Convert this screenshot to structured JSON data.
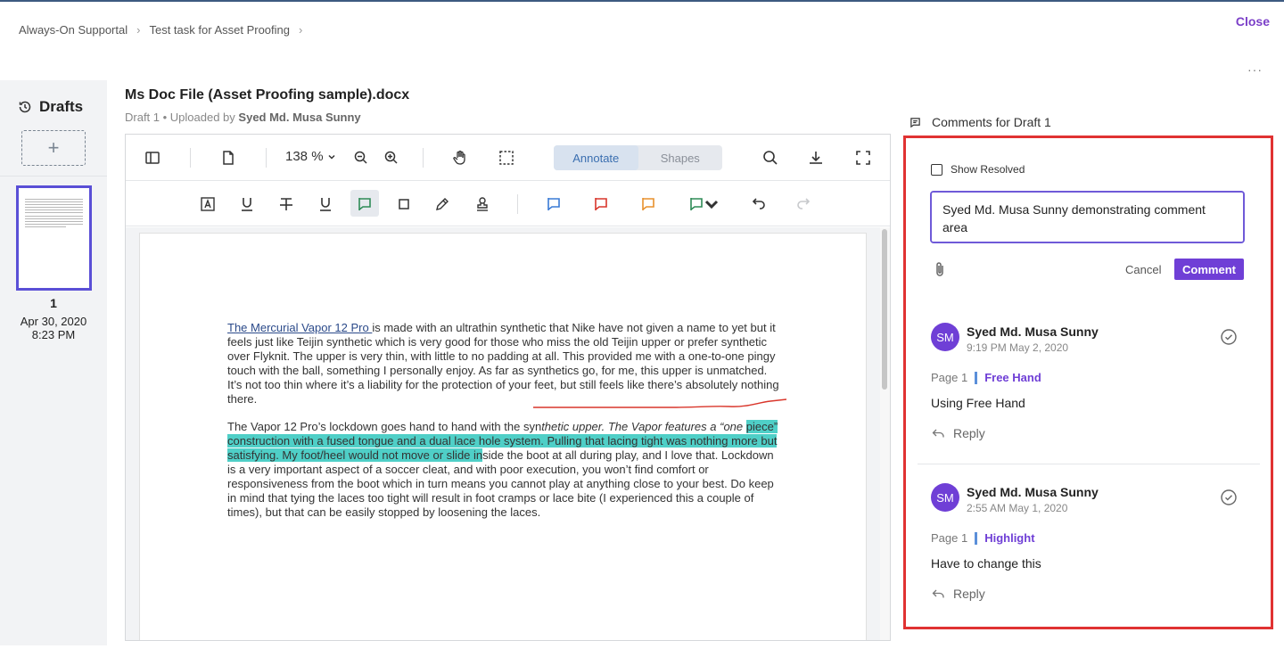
{
  "breadcrumb": {
    "items": [
      "Always-On Supportal",
      "Test task for Asset Proofing"
    ],
    "separator": "›"
  },
  "header": {
    "close_label": "Close",
    "more_label": "···"
  },
  "drafts": {
    "title": "Drafts",
    "add_label": "+",
    "items": [
      {
        "number": "1",
        "date": "Apr 30, 2020",
        "time": "8:23 PM"
      }
    ]
  },
  "document": {
    "title": "Ms Doc File (Asset Proofing sample).docx",
    "draft_label": "Draft 1 • Uploaded by",
    "uploader": "Syed Md. Musa Sunny"
  },
  "toolbar": {
    "zoom": "138 %",
    "modes": [
      "Annotate",
      "Shapes"
    ],
    "active_mode": "Annotate"
  },
  "page_content": {
    "p1_link": "The Mercurial Vapor 12 Pro ",
    "p1_rest": "is made with an ultrathin synthetic that Nike have not given a name to yet but it feels just like Teijin synthetic which is very good for those who miss the old Teijin upper or prefer synthetic over Flyknit. The upper is very thin, with little to no padding at all. This provided me with a one-to-one pingy touch with the ball, something I personally enjoy. As far as synthetics go, for me, this upper is unmatched. It’s not too thin where it’s a liability for the protection of your feet, but still feels like there’s absolutely nothing there.",
    "p2_start": "The Vapor 12 Pro’s lockdown goes hand to hand with the syn",
    "p2_italic": "thetic upper. The Vapor features a “one",
    "p2_highlight": "piece” construction with a fused tongue and a dual lace hole system. Pulling that lacing tight was nothing more but satisfying. My foot/heel would not move or slide in",
    "p2_rest": "side the boot at all during play, and I love that. Lockdown is a very important aspect of a soccer cleat, and with poor execution, you won’t find comfort or responsiveness from the boot which in turn means you cannot play at anything close to your best. Do keep in mind that tying the laces too tight will result in foot cramps or lace bite (I experienced this a couple of times), but that can be easily stopped by loosening the laces."
  },
  "comments_panel": {
    "title": "Comments for Draft 1",
    "show_resolved_label": "Show Resolved",
    "input_value": "Syed Md. Musa Sunny demonstrating comment area",
    "cancel_label": "Cancel",
    "submit_label": "Comment",
    "comments": [
      {
        "initials": "SM",
        "author": "Syed Md. Musa Sunny",
        "time": "9:19 PM May 2, 2020",
        "page": "Page 1",
        "tool": "Free Hand",
        "text": "Using Free Hand",
        "reply_label": "Reply"
      },
      {
        "initials": "SM",
        "author": "Syed Md. Musa Sunny",
        "time": "2:55 AM May 1, 2020",
        "page": "Page 1",
        "tool": "Highlight",
        "text": "Have to change this",
        "reply_label": "Reply"
      }
    ]
  },
  "colors": {
    "accent": "#6f3fd6",
    "highlight": "#4fcfc7",
    "selection_border": "#e03232",
    "annotation_line": "#d9362b"
  }
}
